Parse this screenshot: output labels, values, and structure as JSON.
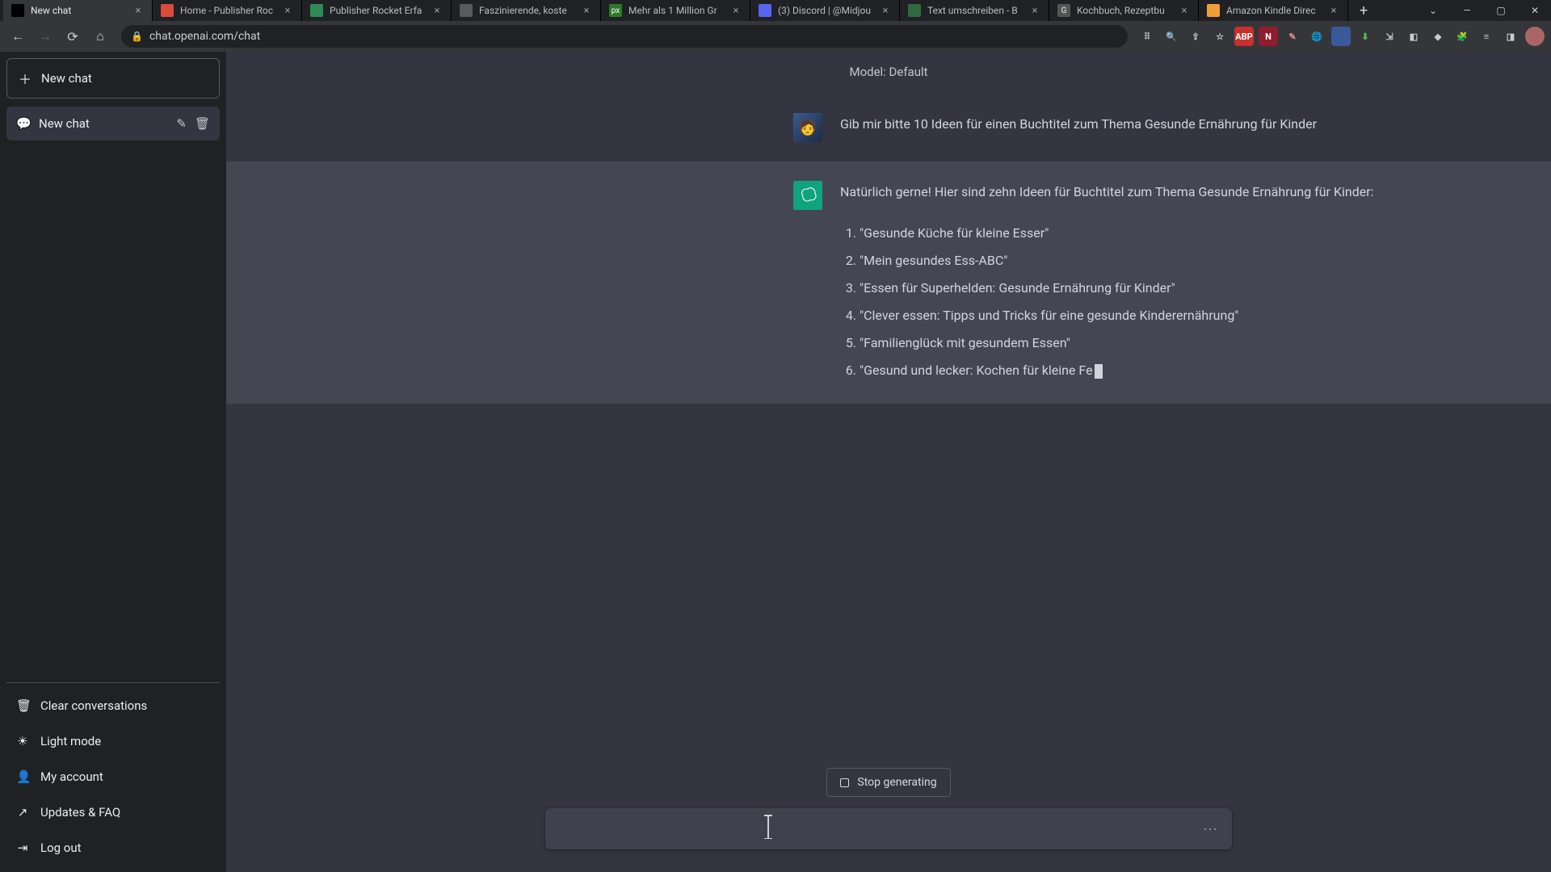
{
  "tabs": [
    {
      "title": "New chat",
      "favicon_bg": "#000",
      "favicon_txt": ""
    },
    {
      "title": "Home - Publisher Roc",
      "favicon_bg": "#d94b3a",
      "favicon_txt": ""
    },
    {
      "title": "Publisher Rocket Erfa",
      "favicon_bg": "#2e8b57",
      "favicon_txt": ""
    },
    {
      "title": "Faszinierende, koste",
      "favicon_bg": "#5a5a5a",
      "favicon_txt": ""
    },
    {
      "title": "Mehr als 1 Million Gr",
      "favicon_bg": "#2b7a2b",
      "favicon_txt": "px"
    },
    {
      "title": "(3) Discord | @Midjou",
      "favicon_bg": "#5865F2",
      "favicon_txt": ""
    },
    {
      "title": "Text umschreiben - B",
      "favicon_bg": "#2f6b3f",
      "favicon_txt": ""
    },
    {
      "title": "Kochbuch, Rezeptbu",
      "favicon_bg": "#555",
      "favicon_txt": "G"
    },
    {
      "title": "Amazon Kindle Direc",
      "favicon_bg": "#f19e38",
      "favicon_txt": ""
    }
  ],
  "address": "chat.openai.com/chat",
  "sidebar": {
    "new_chat": "New chat",
    "conversation": "New chat",
    "bottom": {
      "clear": "Clear conversations",
      "light": "Light mode",
      "account": "My account",
      "faq": "Updates & FAQ",
      "logout": "Log out"
    }
  },
  "model_label": "Model: Default",
  "user_message": "Gib mir bitte 10 Ideen für einen Buchtitel zum Thema Gesunde Ernährung für Kinder",
  "assistant_intro": "Natürlich gerne! Hier sind zehn Ideen für Buchtitel zum Thema Gesunde Ernährung für Kinder:",
  "assistant_items": [
    "\"Gesunde Küche für kleine Esser\"",
    "\"Mein gesundes Ess-ABC\"",
    "\"Essen für Superhelden: Gesunde Ernährung für Kinder\"",
    "\"Clever essen: Tipps und Tricks für eine gesunde Kinderernährung\"",
    "\"Familienglück mit gesundem Essen\"",
    "\"Gesund und lecker: Kochen für kleine Fe"
  ],
  "stop_label": "Stop generating",
  "input_placeholder": ""
}
